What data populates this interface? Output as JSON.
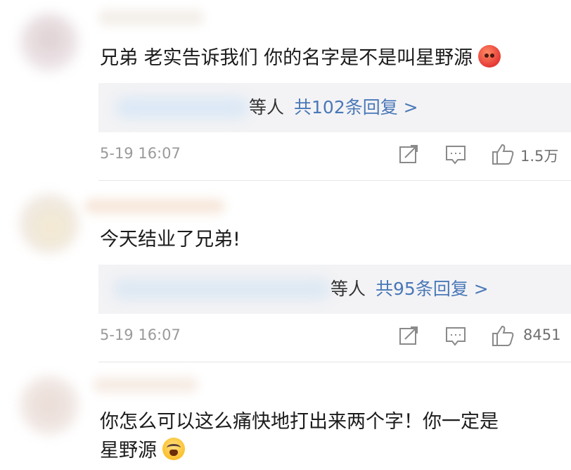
{
  "comments": [
    {
      "text": "兄弟 老实告诉我们 你的名字是不是叫星野源",
      "emoji": "angry-face-emoji",
      "reply_people": "等人",
      "reply_link": "共102条回复 >",
      "time": "5-19 16:07",
      "likes": "1.5万"
    },
    {
      "text": "今天结业了兄弟!",
      "reply_people": "等人",
      "reply_link": "共95条回复 >",
      "time": "5-19 16:07",
      "likes": "8451"
    },
    {
      "text_line1": "你怎么可以这么痛快地打出来两个字！你一定是",
      "text_line2": "星野源",
      "emoji": "crying-face-emoji"
    }
  ],
  "icons": {
    "share": "share-icon",
    "comment": "comment-icon",
    "like": "thumbs-up-icon"
  },
  "colors": {
    "reply_link": "#4a78b8",
    "reply_bg": "#f3f3f5",
    "meta_text": "#9a9a9a"
  }
}
